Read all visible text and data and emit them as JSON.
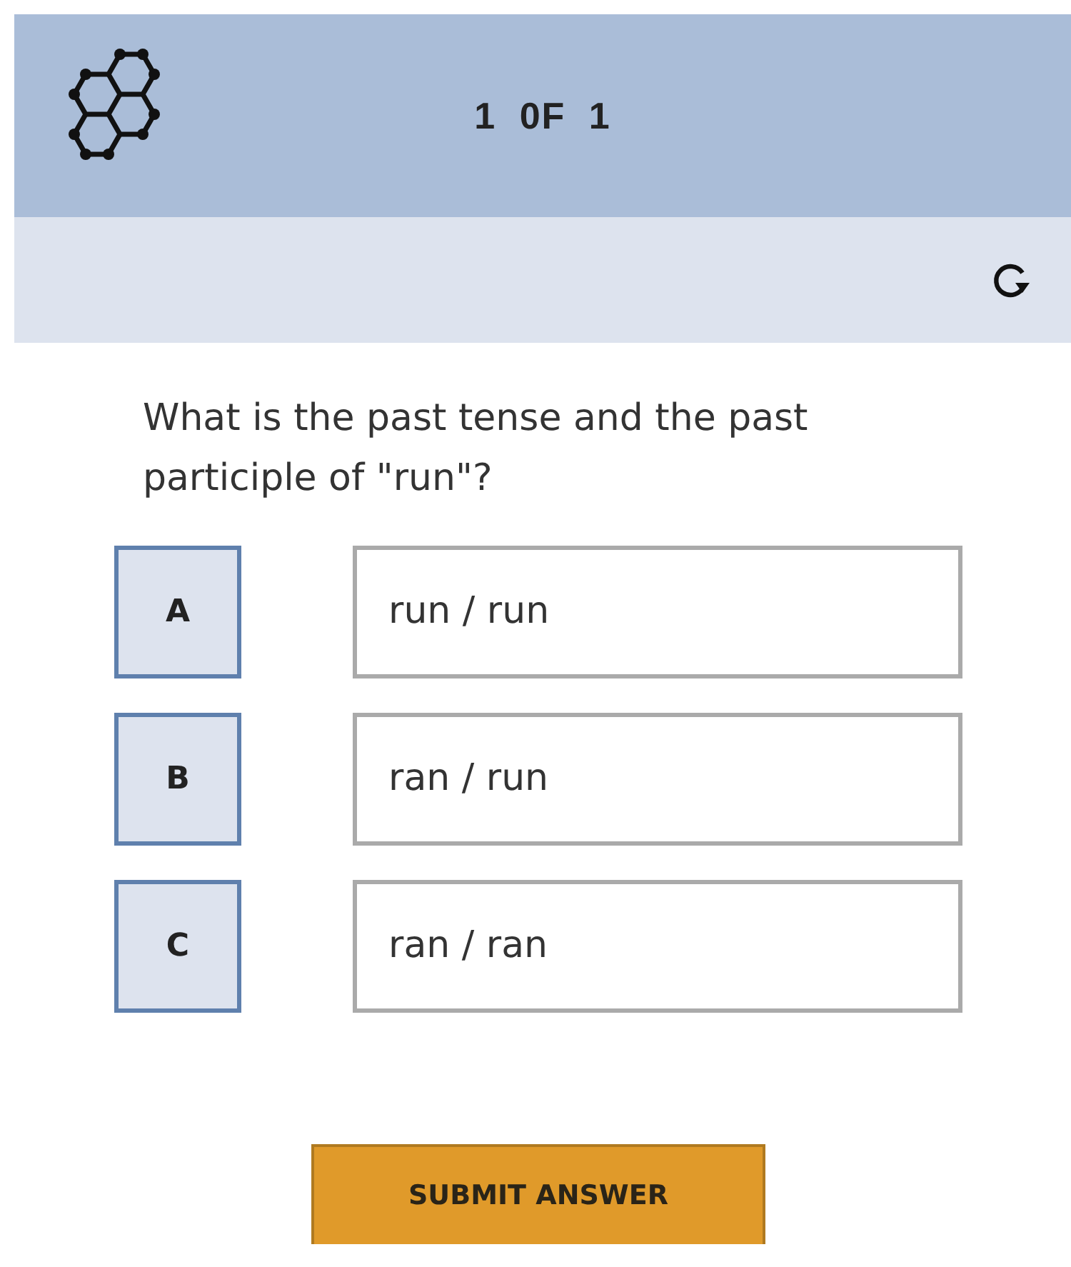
{
  "header": {
    "counter": "1 0F 1"
  },
  "question": "What is the past tense and the past participle of \"run\"?",
  "options": [
    {
      "letter": "A",
      "text": "run / run"
    },
    {
      "letter": "B",
      "text": "ran / run"
    },
    {
      "letter": "C",
      "text": "ran / ran"
    }
  ],
  "submit_button": "SUBMIT ANSWER"
}
